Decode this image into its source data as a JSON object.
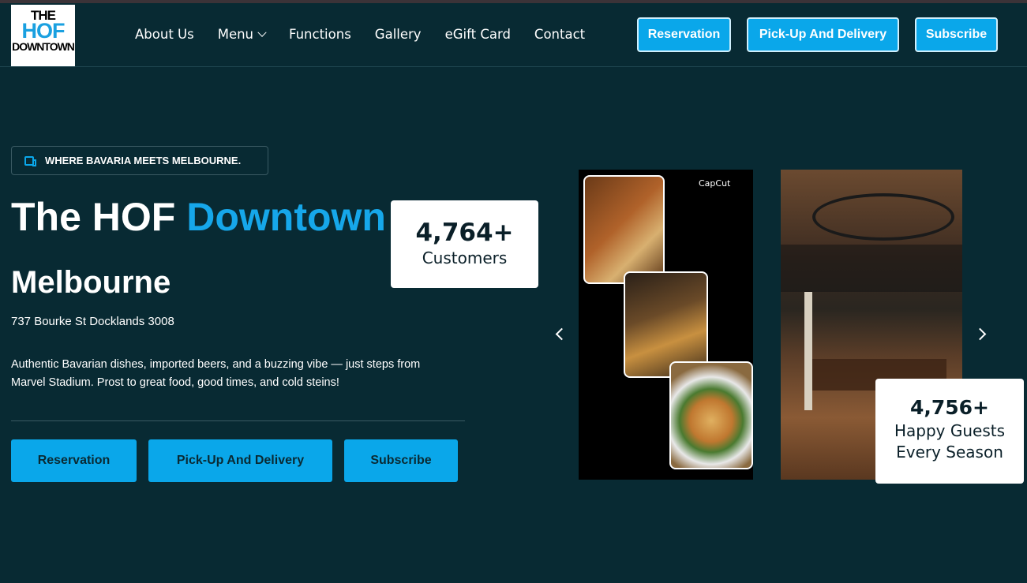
{
  "brand": {
    "logo_line1": "THE",
    "logo_line2": "HOF",
    "logo_line3": "DOWNTOWN",
    "accent_color": "#0aa7ea",
    "background_color": "#082a33"
  },
  "nav": {
    "items": [
      {
        "label": "About Us"
      },
      {
        "label": "Menu",
        "has_dropdown": true
      },
      {
        "label": "Functions"
      },
      {
        "label": "Gallery"
      },
      {
        "label": "eGift Card"
      },
      {
        "label": "Contact"
      }
    ],
    "buttons": [
      {
        "label": "Reservation"
      },
      {
        "label": "Pick-Up And Delivery"
      },
      {
        "label": "Subscribe"
      }
    ]
  },
  "hero": {
    "tagline": "WHERE BAVARIA MEETS MELBOURNE.",
    "title_part1": "The HOF",
    "title_part2": "Downtown",
    "subtitle": "Melbourne",
    "address": "737 Bourke St Docklands 3008",
    "description": "Authentic Bavarian dishes, imported beers, and a buzzing vibe — just steps from Marvel Stadium. Prost to great food, good times, and cold steins!",
    "buttons": [
      {
        "label": "Reservation"
      },
      {
        "label": "Pick-Up And Delivery"
      },
      {
        "label": "Subscribe"
      }
    ]
  },
  "stats": [
    {
      "value": "4,764+",
      "label": "Customers"
    },
    {
      "value": "4,756+",
      "label_line1": "Happy Guests",
      "label_line2": "Every Season"
    }
  ],
  "carousel": {
    "watermark": "CapCut",
    "prev_icon": "chevron-left-icon",
    "next_icon": "chevron-right-icon"
  }
}
